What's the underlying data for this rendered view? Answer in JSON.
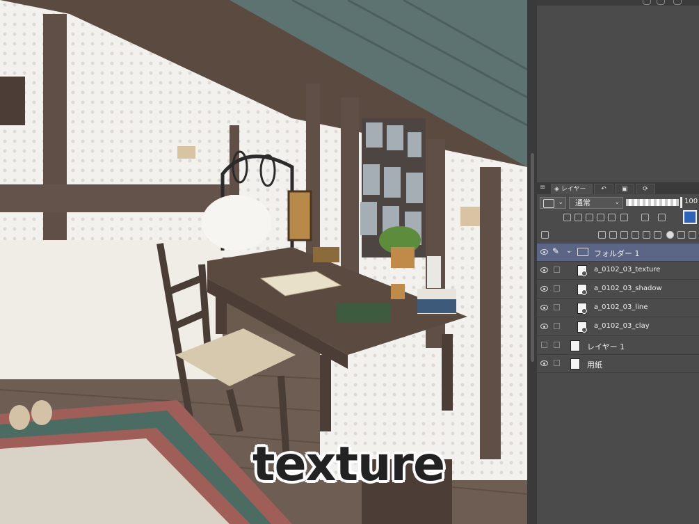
{
  "caption": "texture",
  "panel": {
    "tabs": [
      {
        "label": "レイヤー",
        "icon": "layers-icon"
      },
      {
        "label": "",
        "icon": "history-icon"
      },
      {
        "label": "",
        "icon": "navigator-icon"
      },
      {
        "label": "",
        "icon": "sub-view-icon"
      }
    ],
    "blend_mode": "通常",
    "opacity": "100"
  },
  "layers": [
    {
      "name": "フォルダー 1",
      "type": "folder",
      "selected": true
    },
    {
      "name": "a_0102_03_texture",
      "type": "layer"
    },
    {
      "name": "a_0102_03_shadow",
      "type": "layer"
    },
    {
      "name": "a_0102_03_line",
      "type": "layer"
    },
    {
      "name": "a_0102_03_clay",
      "type": "layer"
    },
    {
      "name": "レイヤー 1",
      "type": "layer",
      "hidden": true
    },
    {
      "name": "用紙",
      "type": "paper"
    }
  ]
}
